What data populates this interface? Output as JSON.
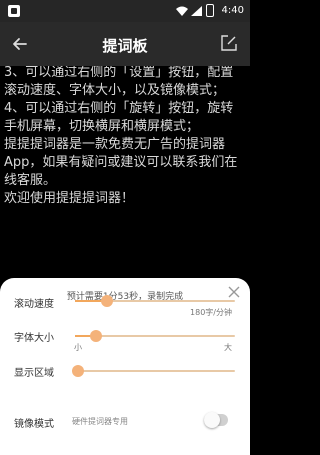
{
  "status_bar": {
    "time": "4:40"
  },
  "app_bar": {
    "title": "提词板"
  },
  "script": {
    "lines": [
      "    3、可以通过右侧的「设置」按钮，配置滚动速度、字体大小，以及镜像模式；",
      "    4、可以通过右侧的「旋转」按钮，旋转手机屏幕，切换横屏和横屏模式；",
      "    提提提词器是一款免费无广告的提词器App，如果有疑问或建议可以联系我们在线客服。",
      "    欢迎使用提提提词器！"
    ]
  },
  "settings": {
    "estimate": "预计需要1分53秒，录制完成",
    "scroll_speed": {
      "label": "滚动速度",
      "value_text": "180字/分钟",
      "level": 0.2
    },
    "font_size": {
      "label": "字体大小",
      "min_label": "小",
      "max_label": "大",
      "level": 0.13
    },
    "display_area": {
      "label": "显示区域",
      "level": 0.02
    },
    "mirror": {
      "label": "镜像模式",
      "hint": "硬件提词器专用",
      "enabled": false
    }
  }
}
